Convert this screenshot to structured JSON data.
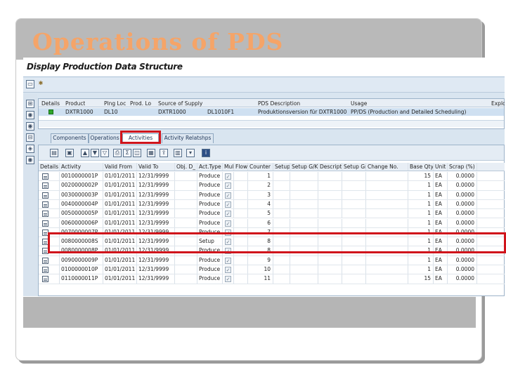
{
  "slide_title": "Operations of PDS",
  "window_title": "Display Production Data Structure",
  "header_table": {
    "columns": [
      "Details",
      "Product",
      "Plng Loc",
      "Prod. Lo",
      "Source of Supply",
      "",
      "PDS Description",
      "Usage",
      "Explos"
    ],
    "row": [
      "",
      "DXTR1000",
      "DL10",
      "",
      "DXTR1000",
      "DL1010F1",
      "Produktionsversion für DXTR1000",
      "PP/DS (Production and Detailed Scheduling)",
      ""
    ]
  },
  "tabs": [
    "Components",
    "Operations",
    "Activities",
    "Activity Relatshps"
  ],
  "active_tab": "Activities",
  "grid": {
    "columns": [
      "Details",
      "Activity",
      "Valid From",
      "Valid To",
      "Obj. D_",
      "Act.Type",
      "Mul",
      "Flow",
      "Counter",
      "Setup",
      "Setup G/K",
      "Descripti",
      "Setup Grp",
      "Change No.",
      "Base Qty",
      "Unit",
      "Scrap (%)"
    ],
    "rows": [
      [
        "0010000001P",
        "01/01/2011",
        "12/31/9999",
        "Produce",
        "1",
        "15",
        "EA",
        "0.0000"
      ],
      [
        "0020000002P",
        "01/01/2011",
        "12/31/9999",
        "Produce",
        "2",
        "1",
        "EA",
        "0.0000"
      ],
      [
        "0030000003P",
        "01/01/2011",
        "12/31/9999",
        "Produce",
        "3",
        "1",
        "EA",
        "0.0000"
      ],
      [
        "0040000004P",
        "01/01/2011",
        "12/31/9999",
        "Produce",
        "4",
        "1",
        "EA",
        "0.0000"
      ],
      [
        "0050000005P",
        "01/01/2011",
        "12/31/9999",
        "Produce",
        "5",
        "1",
        "EA",
        "0.0000"
      ],
      [
        "0060000006P",
        "01/01/2011",
        "12/31/9999",
        "Produce",
        "6",
        "1",
        "EA",
        "0.0000"
      ],
      [
        "0070000007P",
        "01/01/2011",
        "12/31/9999",
        "Produce",
        "7",
        "1",
        "EA",
        "0.0000"
      ],
      [
        "0080000008S",
        "01/01/2011",
        "12/31/9999",
        "Setup",
        "8",
        "1",
        "EA",
        "0.0000"
      ],
      [
        "0080000008P",
        "01/01/2011",
        "12/31/9999",
        "Produce",
        "8",
        "1",
        "EA",
        "0.0000"
      ],
      [
        "0090000009P",
        "01/01/2011",
        "12/31/9999",
        "Produce",
        "9",
        "1",
        "EA",
        "0.0000"
      ],
      [
        "0100000010P",
        "01/01/2011",
        "12/31/9999",
        "Produce",
        "10",
        "1",
        "EA",
        "0.0000"
      ],
      [
        "0110000011P",
        "01/01/2011",
        "12/31/9999",
        "Produce",
        "11",
        "15",
        "EA",
        "0.0000"
      ]
    ]
  },
  "colors": {
    "title": "#f5a468",
    "highlight": "#d0141b",
    "selected_row": "#cfe0f1"
  },
  "icons": [
    "folder-icon",
    "settings-icon",
    "expand-icon",
    "find-icon",
    "filter-icon",
    "print-icon",
    "export-icon",
    "info-icon",
    "checkbox-icon",
    "document-icon",
    "green-status-icon"
  ]
}
